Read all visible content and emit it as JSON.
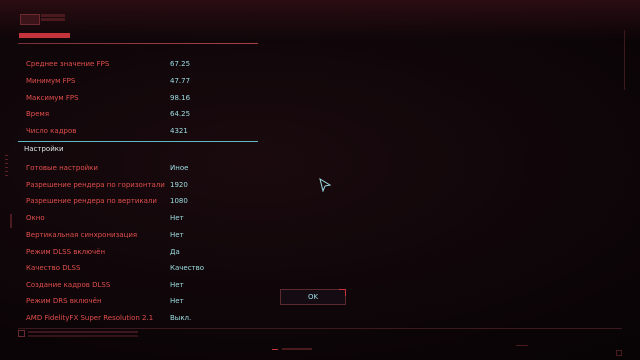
{
  "stats": {
    "rows": [
      {
        "label": "Среднее значение FPS",
        "value": "67.25"
      },
      {
        "label": "Минимум FPS",
        "value": "47.77"
      },
      {
        "label": "Максимум FPS",
        "value": "98.16"
      },
      {
        "label": "Время",
        "value": "64.25"
      },
      {
        "label": "Число кадров",
        "value": "4321"
      }
    ]
  },
  "settings": {
    "title": "Настройки",
    "rows": [
      {
        "label": "Готовые настройки",
        "value": "Иное"
      },
      {
        "label": "Разрешение рендера по горизонтали",
        "value": "1920"
      },
      {
        "label": "Разрешение рендера по вертикали",
        "value": "1080"
      },
      {
        "label": "Окно",
        "value": "Нет"
      },
      {
        "label": "Вертикальная синхронизация",
        "value": "Нет"
      },
      {
        "label": "Режим DLSS включён",
        "value": "Да"
      },
      {
        "label": "Качество DLSS",
        "value": "Качество"
      },
      {
        "label": "Создание кадров DLSS",
        "value": "Нет"
      },
      {
        "label": "Режим DRS включён",
        "value": "Нет"
      },
      {
        "label": "AMD FidelityFX Super Resolution 2.1",
        "value": "Выкл."
      }
    ]
  },
  "ok_button": {
    "label": "OK"
  },
  "icons": {
    "cursor": "pointer-cursor-icon",
    "logo": "game-logo-icon"
  },
  "colors": {
    "label_red": "#e24e4c",
    "value_cyan": "#9ddfe4",
    "section_line": "#5eb9c2",
    "accent_red": "#c4343c",
    "background": "#0f0609"
  }
}
